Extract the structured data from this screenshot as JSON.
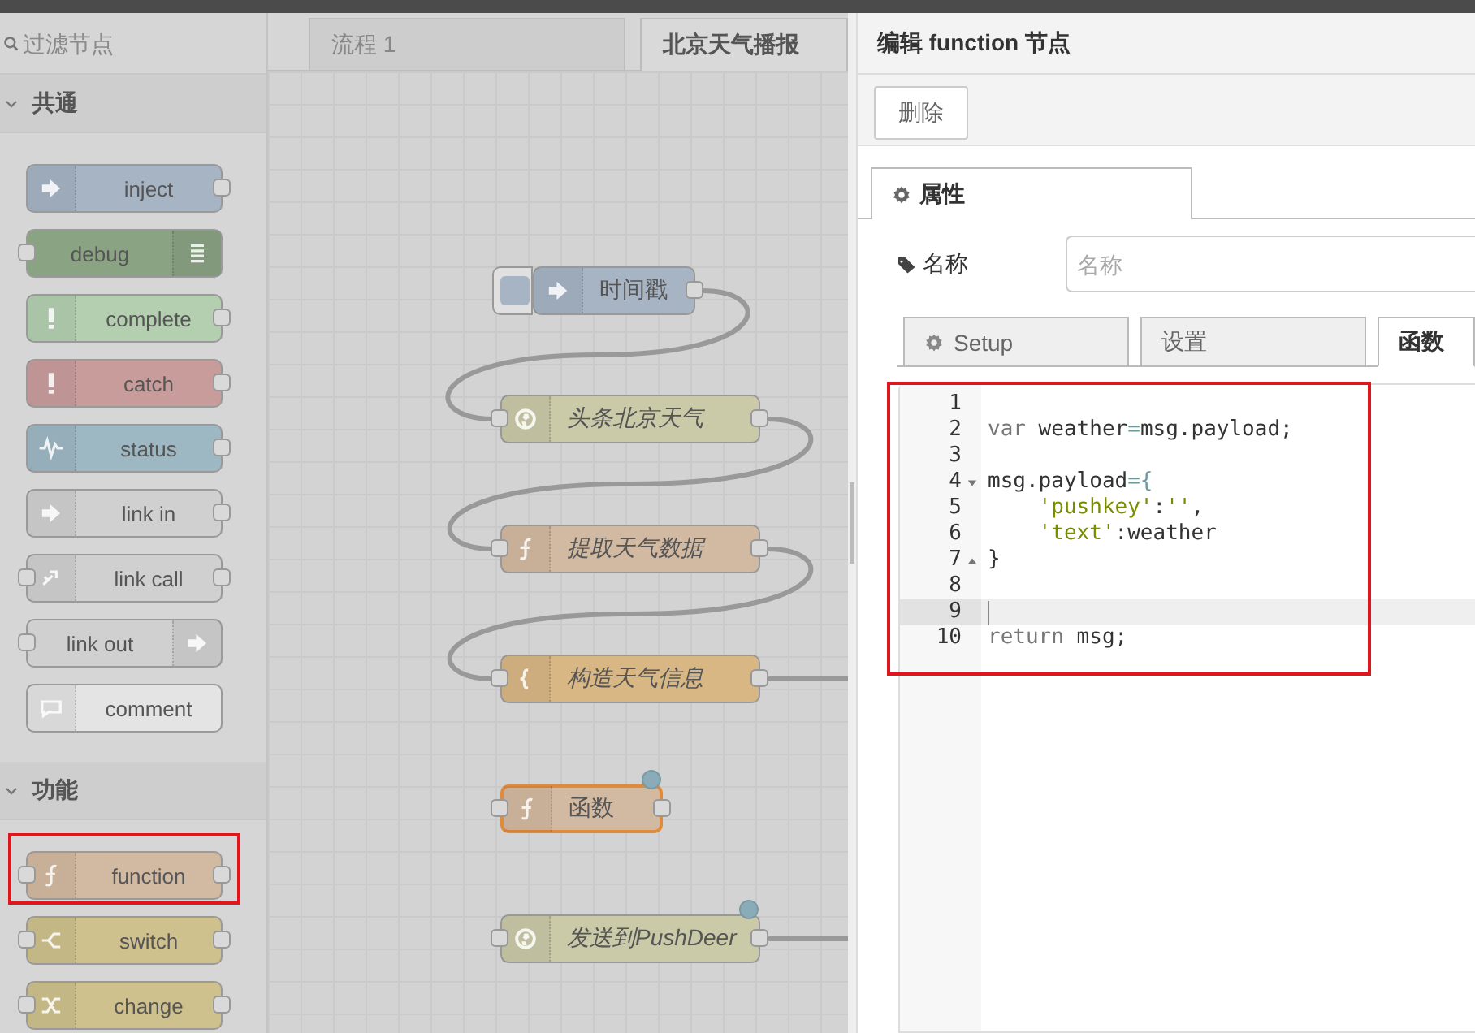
{
  "palette": {
    "filter_placeholder": "过滤节点",
    "categories": [
      {
        "title": "共通",
        "expanded": true,
        "nodes": [
          {
            "label": "inject",
            "color": "#a6b4c4",
            "kind": "inject",
            "icon_right": false,
            "input": false,
            "output": true
          },
          {
            "label": "debug",
            "color": "#8aa382",
            "kind": "debug",
            "icon_right": true,
            "input": true,
            "output": false
          },
          {
            "label": "complete",
            "color": "#b4cfb0",
            "kind": "complete",
            "icon_right": false,
            "input": false,
            "output": true
          },
          {
            "label": "catch",
            "color": "#c99c9c",
            "kind": "catch",
            "icon_right": false,
            "input": false,
            "output": true
          },
          {
            "label": "status",
            "color": "#9eb8c3",
            "kind": "status",
            "icon_right": false,
            "input": false,
            "output": true
          },
          {
            "label": "link in",
            "color": "#d0d0d0",
            "kind": "link-in",
            "icon_right": false,
            "input": false,
            "output": true
          },
          {
            "label": "link call",
            "color": "#d0d0d0",
            "kind": "link-call",
            "icon_right": false,
            "input": true,
            "output": true
          },
          {
            "label": "link out",
            "color": "#d0d0d0",
            "kind": "link-out",
            "icon_right": true,
            "input": true,
            "output": false
          },
          {
            "label": "comment",
            "color": "#e4e4e4",
            "kind": "comment",
            "icon_right": false,
            "input": false,
            "output": false
          }
        ]
      },
      {
        "title": "功能",
        "expanded": true,
        "nodes": [
          {
            "label": "function",
            "color": "#d2b9a1",
            "kind": "function",
            "icon_right": false,
            "input": true,
            "output": true,
            "highlighted": true
          },
          {
            "label": "switch",
            "color": "#cfc18e",
            "kind": "switch",
            "icon_right": false,
            "input": true,
            "output": true
          },
          {
            "label": "change",
            "color": "#cfc18e",
            "kind": "change",
            "icon_right": false,
            "input": true,
            "output": true
          }
        ]
      }
    ]
  },
  "workspace": {
    "tabs": [
      {
        "label": "流程 1",
        "selected": false
      },
      {
        "label": "北京天气播报",
        "selected": true
      }
    ],
    "nodes": [
      {
        "label": "时间戳",
        "color": "#a6b4c4",
        "kind": "inject",
        "italic": false,
        "selected": false,
        "changed": false,
        "wired_to_next": true,
        "wired_offscreen": false
      },
      {
        "label": "头条北京天气",
        "color": "#cacaa8",
        "kind": "http",
        "italic": true,
        "selected": false,
        "changed": false,
        "wired_to_next": true,
        "wired_offscreen": false
      },
      {
        "label": "提取天气数据",
        "color": "#d2b9a1",
        "kind": "function",
        "italic": true,
        "selected": false,
        "changed": false,
        "wired_to_next": true,
        "wired_offscreen": false
      },
      {
        "label": "构造天气信息",
        "color": "#d9b784",
        "kind": "template",
        "italic": true,
        "selected": false,
        "changed": false,
        "wired_to_next": false,
        "wired_offscreen": true
      },
      {
        "label": "函数",
        "color": "#d2b9a1",
        "kind": "function",
        "italic": false,
        "selected": true,
        "changed": true,
        "wired_to_next": false,
        "wired_offscreen": false
      },
      {
        "label": "发送到PushDeer",
        "color": "#cacaa8",
        "kind": "http",
        "italic": true,
        "selected": false,
        "changed": true,
        "wired_to_next": false,
        "wired_offscreen": true
      }
    ]
  },
  "editor": {
    "title": "编辑 function 节点",
    "delete_button": "删除",
    "tabs": [
      {
        "label": "属性",
        "selected": true
      }
    ],
    "name_label": "名称",
    "name_placeholder": "名称",
    "subtabs": [
      {
        "label": "Setup",
        "kind": "gear",
        "selected": false
      },
      {
        "label": "设置",
        "kind": "plain",
        "selected": false
      },
      {
        "label": "函数",
        "kind": "plain",
        "selected": true
      }
    ],
    "code": {
      "highlighted": true,
      "lines": [
        {
          "number": "1",
          "fold_start": false,
          "fold_end": false,
          "active": false
        },
        {
          "number": "2",
          "fold_start": false,
          "fold_end": false,
          "active": false,
          "tokens": [
            {
              "kind": "keyword",
              "text": "var"
            },
            {
              "kind": "plain",
              "text": " weather"
            },
            {
              "kind": "operator",
              "text": "="
            },
            {
              "kind": "plain",
              "text": "msg.payload;"
            }
          ]
        },
        {
          "number": "3",
          "fold_start": false,
          "fold_end": false,
          "active": false
        },
        {
          "number": "4",
          "fold_start": true,
          "fold_end": false,
          "active": false,
          "tokens": [
            {
              "kind": "plain",
              "text": "msg.payload"
            },
            {
              "kind": "operator",
              "text": "={"
            }
          ]
        },
        {
          "number": "5",
          "fold_start": false,
          "fold_end": false,
          "active": false,
          "tokens": [
            {
              "kind": "string",
              "text": "    'pushkey'"
            },
            {
              "kind": "plain",
              "text": ":"
            },
            {
              "kind": "string",
              "text": "''"
            },
            {
              "kind": "plain",
              "text": ","
            }
          ]
        },
        {
          "number": "6",
          "fold_start": false,
          "fold_end": false,
          "active": false,
          "tokens": [
            {
              "kind": "string",
              "text": "    'text'"
            },
            {
              "kind": "plain",
              "text": ":weather"
            }
          ]
        },
        {
          "number": "7",
          "fold_start": false,
          "fold_end": true,
          "active": false,
          "tokens": [
            {
              "kind": "plain",
              "text": "}"
            }
          ]
        },
        {
          "number": "8",
          "fold_start": false,
          "fold_end": false,
          "active": false
        },
        {
          "number": "9",
          "fold_start": false,
          "fold_end": false,
          "active": true
        },
        {
          "number": "10",
          "fold_start": false,
          "fold_end": false,
          "active": false,
          "tokens": [
            {
              "kind": "keyword",
              "text": "return"
            },
            {
              "kind": "plain",
              "text": " msg;"
            }
          ]
        }
      ]
    }
  }
}
